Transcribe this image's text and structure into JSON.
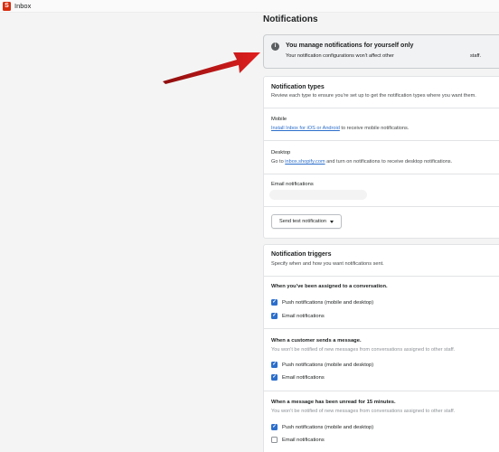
{
  "app": {
    "logo_letter": "S",
    "title": "Inbox"
  },
  "page": {
    "title": "Notifications"
  },
  "banner": {
    "icon": "info-icon",
    "title": "You manage notifications for yourself only",
    "text": "Your notification configurations won't affect other",
    "text_end": "staff."
  },
  "types_card": {
    "title": "Notification types",
    "subtitle": "Review each type to ensure you're set up to get the notification types where you want them.",
    "mobile": {
      "label": "Mobile",
      "link": "Install Inbox for iOS or Android",
      "text": " to receive mobile notifications."
    },
    "desktop": {
      "label": "Desktop",
      "pre": "Go to ",
      "link": "inbox.shopify.com",
      "text": " and turn on notifications to receive desktop notifications."
    },
    "email": {
      "label": "Email notifications"
    },
    "test_button": "Send test notification"
  },
  "triggers_card": {
    "title": "Notification triggers",
    "subtitle": "Specify when and how you want notifications sent.",
    "triggers": [
      {
        "title": "When you've been assigned to a conversation.",
        "note": "",
        "push_label": "Push notifications (mobile and desktop)",
        "push_checked": true,
        "email_label": "Email notifications",
        "email_checked": true
      },
      {
        "title": "When a customer sends a message.",
        "note": "You won't be notified of new messages from conversations assigned to other staff.",
        "push_label": "Push notifications (mobile and desktop)",
        "push_checked": true,
        "email_label": "Email notifications",
        "email_checked": true
      },
      {
        "title": "When a message has been unread for 15 minutes.",
        "note": "You won't be notified of new messages from conversations assigned to other staff.",
        "push_label": "Push notifications (mobile and desktop)",
        "push_checked": true,
        "email_label": "Email notifications",
        "email_checked": false
      }
    ]
  },
  "colors": {
    "accent": "#2c6ecb",
    "arrow": "#d11a1a",
    "logo": "#d72c0d"
  }
}
